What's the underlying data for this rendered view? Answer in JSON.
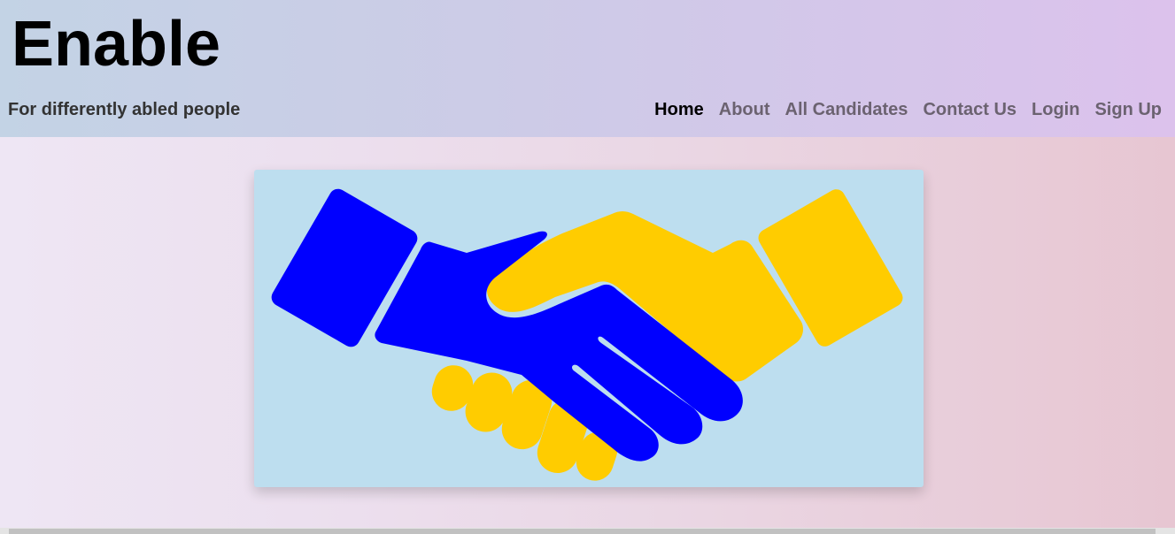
{
  "header": {
    "title": "Enable",
    "tagline": "For differently abled people"
  },
  "nav": {
    "items": [
      {
        "label": "Home",
        "active": true
      },
      {
        "label": "About",
        "active": false
      },
      {
        "label": "All Candidates",
        "active": false
      },
      {
        "label": "Contact Us",
        "active": false
      },
      {
        "label": "Login",
        "active": false
      },
      {
        "label": "Sign Up",
        "active": false
      }
    ]
  },
  "hero": {
    "icon": "handshake-icon",
    "colors": {
      "background": "#bddeef",
      "left_hand": "#0000ff",
      "right_hand": "#ffcc00"
    }
  },
  "colors": {
    "header_gradient_start": "#c3d3e5",
    "header_gradient_end": "#dcc2ec",
    "nav_active": "#000000",
    "nav_inactive": "#6b6270"
  }
}
